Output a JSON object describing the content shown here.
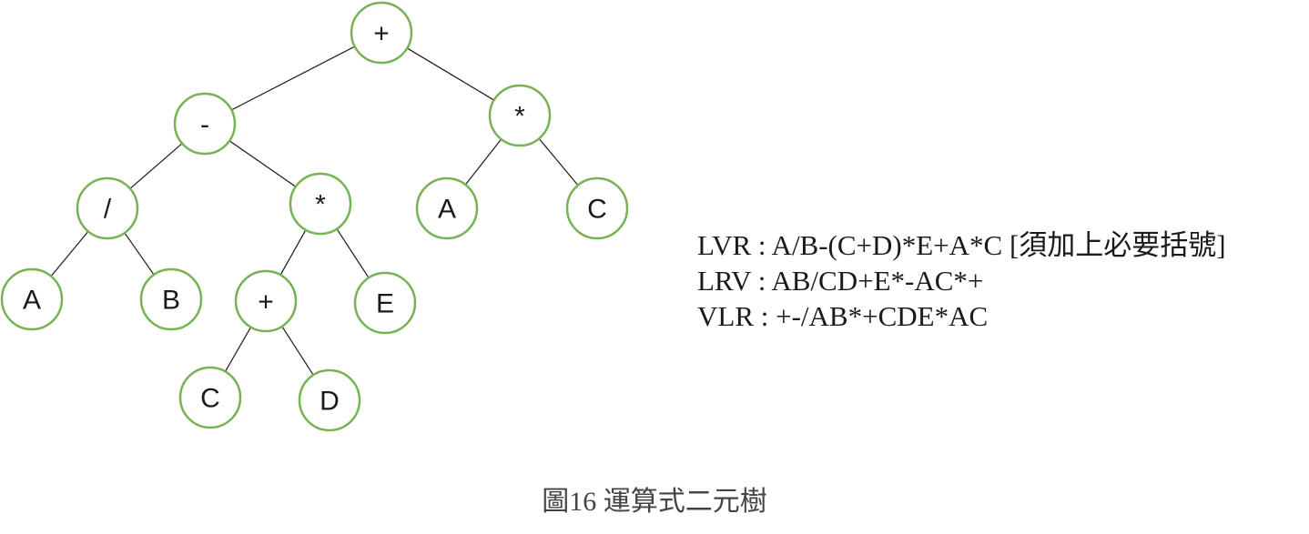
{
  "tree": {
    "nodes": [
      {
        "id": "n-root",
        "label": "+"
      },
      {
        "id": "n-minus",
        "label": "-"
      },
      {
        "id": "n-mul-right",
        "label": "*"
      },
      {
        "id": "n-div",
        "label": "/"
      },
      {
        "id": "n-mul-mid",
        "label": "*"
      },
      {
        "id": "n-a-right",
        "label": "A"
      },
      {
        "id": "n-c-right",
        "label": "C"
      },
      {
        "id": "n-a-left",
        "label": "A"
      },
      {
        "id": "n-b",
        "label": "B"
      },
      {
        "id": "n-plus",
        "label": "+"
      },
      {
        "id": "n-e",
        "label": "E"
      },
      {
        "id": "n-c-bottom",
        "label": "C"
      },
      {
        "id": "n-d",
        "label": "D"
      }
    ],
    "edges": [
      [
        "n-root",
        "n-minus"
      ],
      [
        "n-root",
        "n-mul-right"
      ],
      [
        "n-minus",
        "n-div"
      ],
      [
        "n-minus",
        "n-mul-mid"
      ],
      [
        "n-mul-right",
        "n-a-right"
      ],
      [
        "n-mul-right",
        "n-c-right"
      ],
      [
        "n-div",
        "n-a-left"
      ],
      [
        "n-div",
        "n-b"
      ],
      [
        "n-mul-mid",
        "n-plus"
      ],
      [
        "n-mul-mid",
        "n-e"
      ],
      [
        "n-plus",
        "n-c-bottom"
      ],
      [
        "n-plus",
        "n-d"
      ]
    ],
    "colors": {
      "node_border": "#77b255",
      "edge": "#1a1a1a"
    }
  },
  "traversals": {
    "lvr": "LVR : A/B-(C+D)*E+A*C [須加上必要括號]",
    "lrv": "LRV : AB/CD+E*-AC*+",
    "vlr": "VLR : +-/AB*+CDE*AC"
  },
  "caption": "圖16 運算式二元樹"
}
